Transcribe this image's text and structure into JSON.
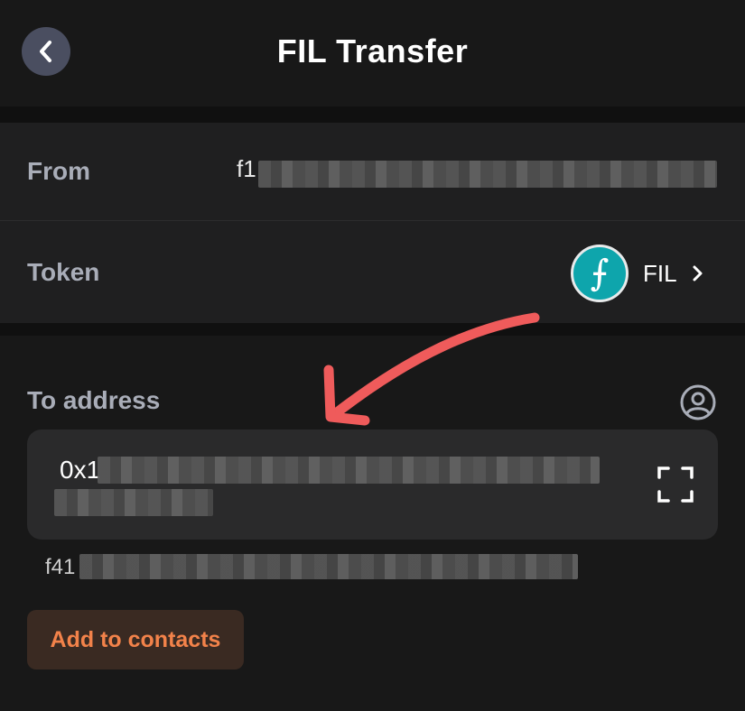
{
  "header": {
    "title": "FIL Transfer",
    "back_icon": "chevron-left-icon"
  },
  "from": {
    "label": "From",
    "value_visible_prefix": "f1",
    "value_state": "pixelated"
  },
  "token": {
    "label": "Token",
    "name": "FIL",
    "logo_glyph": "⨍",
    "logo_color": "#0ea5ac",
    "chevron_icon": "chevron-right-icon"
  },
  "to_address": {
    "label": "To address",
    "contact_icon": "person-circle-icon",
    "input_prefix": "0x1",
    "input_state": "pixelated",
    "scan_icon": "scan-icon",
    "converted_prefix": "f41"
  },
  "actions": {
    "add_to_contacts_label": "Add to contacts",
    "accent_color": "#f2824a"
  },
  "annotation": {
    "arrow_color": "#ef5b5b"
  }
}
